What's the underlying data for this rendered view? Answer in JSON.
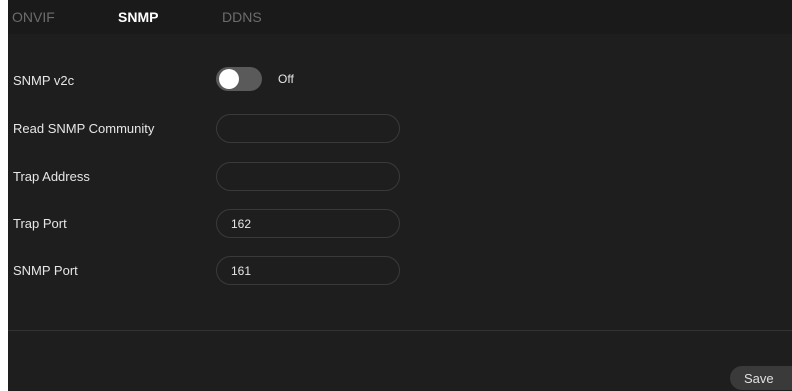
{
  "tabs": [
    {
      "label": "ONVIF",
      "active": false
    },
    {
      "label": "SNMP",
      "active": true
    },
    {
      "label": "DDNS",
      "active": false
    }
  ],
  "form": {
    "snmp_v2c": {
      "label": "SNMP v2c",
      "enabled": false,
      "state_text": "Off"
    },
    "read_community": {
      "label": "Read SNMP Community",
      "value": ""
    },
    "trap_address": {
      "label": "Trap Address",
      "value": ""
    },
    "trap_port": {
      "label": "Trap Port",
      "value": "162"
    },
    "snmp_port": {
      "label": "SNMP Port",
      "value": "161"
    }
  },
  "footer": {
    "save_label": "Save"
  },
  "colors": {
    "background": "#1e1e1e",
    "text": "#e6e6e6",
    "inactive_tab": "#6c6c6c",
    "toggle_off": "#5a5a5a",
    "field_border": "#3a3a3a"
  }
}
